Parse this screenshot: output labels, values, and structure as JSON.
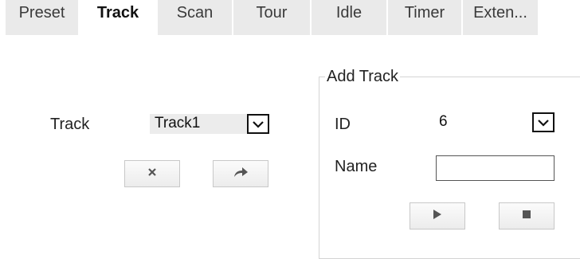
{
  "tabs": [
    {
      "label": "Preset"
    },
    {
      "label": "Track"
    },
    {
      "label": "Scan"
    },
    {
      "label": "Tour"
    },
    {
      "label": "Idle"
    },
    {
      "label": "Timer"
    },
    {
      "label": "Exten..."
    }
  ],
  "active_tab": "Track",
  "track_panel": {
    "track_label": "Track",
    "track_select_value": "Track1",
    "delete_icon": "close-icon",
    "call_icon": "arrow-right-icon"
  },
  "add_track": {
    "legend": "Add Track",
    "id_label": "ID",
    "id_value": "6",
    "name_label": "Name",
    "name_value": "",
    "start_icon": "play-icon",
    "stop_icon": "stop-icon"
  }
}
